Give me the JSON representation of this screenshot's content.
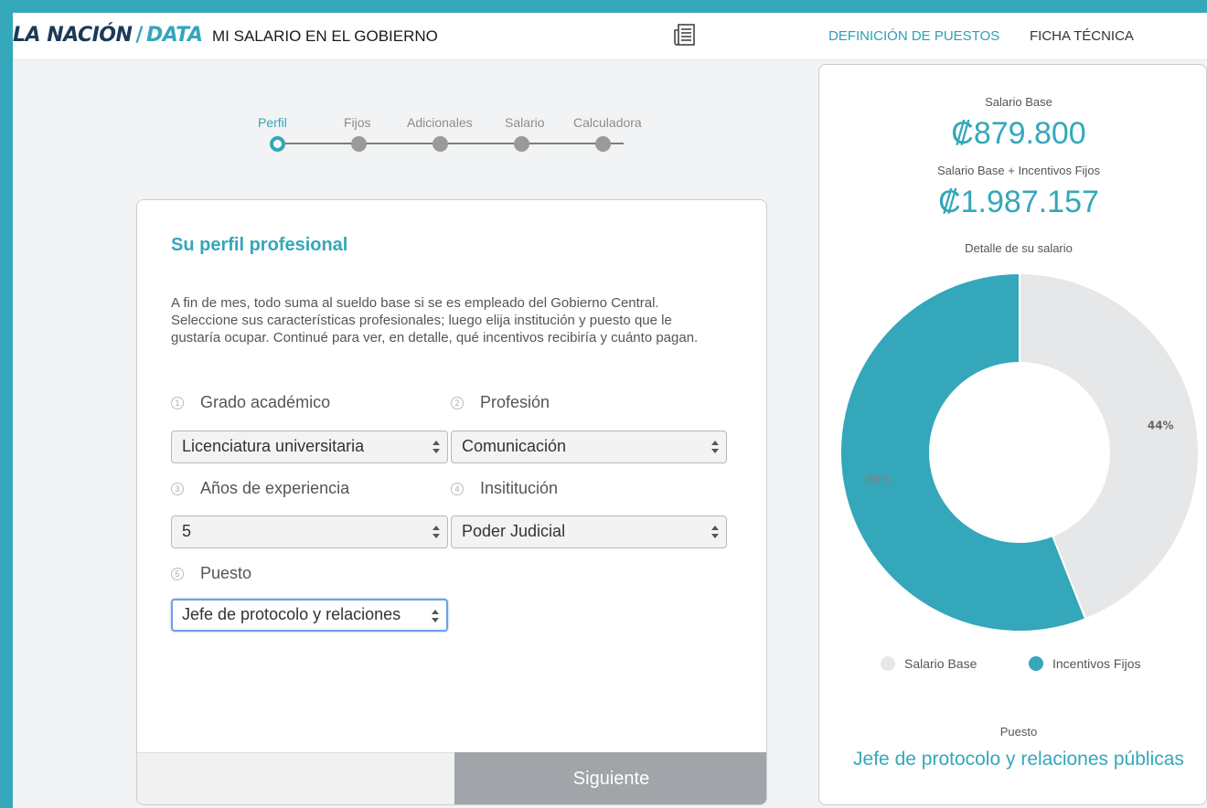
{
  "header": {
    "logo_main": "LA NACIÓN",
    "logo_slash": "/",
    "logo_data": "DATA",
    "title": "MI SALARIO EN EL GOBIERNO",
    "doc_icon": "newspaper-icon",
    "nav": [
      "DEFINICIÓN DE PUESTOS",
      "FICHA TÉCNICA"
    ]
  },
  "stepper": {
    "steps": [
      "Perfil",
      "Fijos",
      "Adicionales",
      "Salario",
      "Calculadora"
    ],
    "active_index": 0
  },
  "form": {
    "title": "Su perfil profesional",
    "intro": "A fin de mes, todo suma al sueldo base si se es empleado del Gobierno Central. Seleccione sus características profesionales; luego elija institución y puesto que le gustaría ocupar. Continué para ver, en detalle, qué incentivos recibiría y cuánto pagan.",
    "fields": [
      {
        "num": "1",
        "label": "Grado académico",
        "value": "Licenciatura universitaria"
      },
      {
        "num": "2",
        "label": "Profesión",
        "value": "Comunicación"
      },
      {
        "num": "3",
        "label": "Años de experiencia",
        "value": "5"
      },
      {
        "num": "4",
        "label": "Insititución",
        "value": "Poder Judicial"
      },
      {
        "num": "5",
        "label": "Puesto",
        "value": "Jefe de protocolo y relaciones"
      }
    ],
    "next_label": "Siguiente"
  },
  "summary": {
    "base_label": "Salario Base",
    "base_value": "₡879.800",
    "total_label": "Salario Base + Incentivos Fijos",
    "total_value": "₡1.987.157",
    "detail_label": "Detalle de su salario",
    "puesto_label": "Puesto",
    "puesto_value": "Jefe de protocolo y relaciones públicas"
  },
  "chart_data": {
    "type": "pie",
    "title": "Detalle de su salario",
    "donut": true,
    "categories": [
      "Salario Base",
      "Incentivos Fijos"
    ],
    "values": [
      44,
      56
    ],
    "labels": [
      "44%",
      "56%"
    ],
    "colors": [
      "#e6e7e8",
      "#34a7ba"
    ],
    "legend": "bottom"
  },
  "colors": {
    "accent": "#34a7ba",
    "navy": "#1b3a57",
    "button_gray": "#a1a4a8"
  }
}
